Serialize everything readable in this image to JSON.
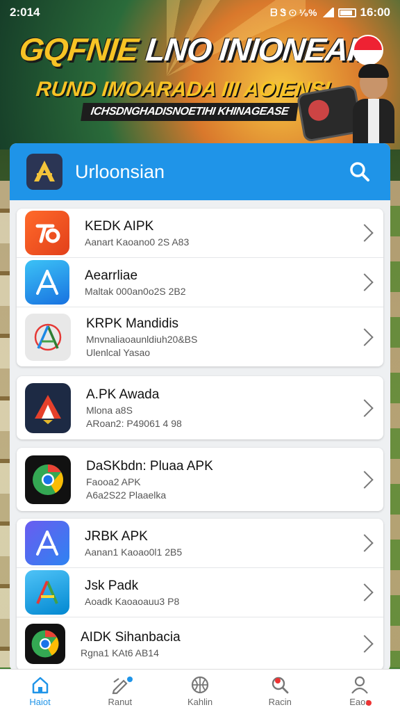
{
  "status_bar": {
    "time": "2:014",
    "indicators": "ᗷ Ꮥ ⊙ ¹⁄₉% ",
    "clock": "16:00"
  },
  "banner": {
    "title_part1": "GQFNIE",
    "title_part2": " LNO  INIONEAII",
    "subtitle": "RUND IMOARADA  III AOIENSI",
    "strip": "ICHSDNGHADISNOETIHI KHINAGEASE"
  },
  "app_bar": {
    "logo_icon": "app-logo-icon",
    "title": "Urloonsian",
    "search_icon": "search-icon"
  },
  "groups": [
    {
      "items": [
        {
          "name": "KEDK AIPK",
          "meta": [
            "Aanart Kaoano0 2S A83"
          ],
          "icon": "orange-app-icon"
        },
        {
          "name": "Aearrliae",
          "meta": [
            "Maltak 000an0o2S 2B2"
          ],
          "icon": "blue-a-icon"
        },
        {
          "name": "KRPK Mandidis",
          "meta": [
            "Mnvnaliaoaunldiuh20&BS",
            "Ulenlcal Yasao"
          ],
          "icon": "multicolor-a-icon"
        }
      ]
    },
    {
      "items": [
        {
          "name": "A.PK Awada",
          "meta": [
            "Mlona            a8S",
            "ARoan2:  P49061 4 98"
          ],
          "icon": "red-triangle-apk-icon"
        }
      ]
    },
    {
      "items": [
        {
          "name": "DaSKbdn: Pluaa APK",
          "meta": [
            "Faooa2 APK",
            "A6a2S22 Plaaelka"
          ],
          "icon": "chrome-style-icon"
        }
      ]
    },
    {
      "items": [
        {
          "name": "JRBK APK",
          "meta": [
            "Aanan1 Kaoao0l1 2B5"
          ],
          "icon": "blue-a-gradient-icon"
        },
        {
          "name": "Jsk Padk",
          "meta": [
            "Aoadk Kaoaoauu3 P8"
          ],
          "icon": "colorful-a-icon"
        },
        {
          "name": "AIDK Sihanbacia",
          "meta": [
            "Rgna1 KAt6 AB14"
          ],
          "icon": "chrome-dark-icon"
        }
      ]
    }
  ],
  "bottom_nav": [
    {
      "label": "Haiot",
      "icon": "home-icon",
      "active": true
    },
    {
      "label": "Ranut",
      "icon": "edit-icon",
      "active": false
    },
    {
      "label": "Kahlin",
      "icon": "basketball-icon",
      "active": false
    },
    {
      "label": "Racin",
      "icon": "search-icon",
      "active": false
    },
    {
      "label": "Eaoa",
      "icon": "profile-icon",
      "active": false
    }
  ],
  "colors": {
    "accent": "#1f94e8",
    "banner_yellow": "#f7c325"
  }
}
